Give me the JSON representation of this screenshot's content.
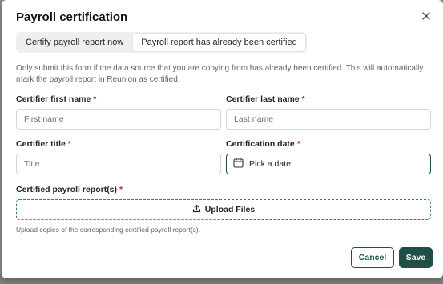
{
  "dialog": {
    "title": "Payroll certification",
    "close_icon": "close-icon"
  },
  "tabs": [
    {
      "label": "Certify payroll report now",
      "active": false
    },
    {
      "label": "Payroll report has already been certified",
      "active": true
    }
  ],
  "notice": "Only submit this form if the data source that you are copying from has already been certified. This will automatically mark the payroll report in Reunion as certified.",
  "fields": {
    "first_name": {
      "label": "Certifier first name",
      "placeholder": "First name",
      "value": ""
    },
    "last_name": {
      "label": "Certifier last name",
      "placeholder": "Last name",
      "value": ""
    },
    "title": {
      "label": "Certifier title",
      "placeholder": "Title",
      "value": ""
    },
    "date": {
      "label": "Certification date",
      "placeholder": "Pick a date",
      "icon": "calendar-icon"
    },
    "reports": {
      "label": "Certified payroll report(s)"
    }
  },
  "required_marker": "*",
  "upload": {
    "label": "Upload Files",
    "icon": "upload-icon",
    "hint": "Upload copies of the corresponding certified payroll report(s)."
  },
  "actions": {
    "cancel_label": "Cancel",
    "save_label": "Save"
  },
  "colors": {
    "brand": "#1f4f46",
    "required": "#d12a2a",
    "upload_border": "#3f7a6c"
  }
}
